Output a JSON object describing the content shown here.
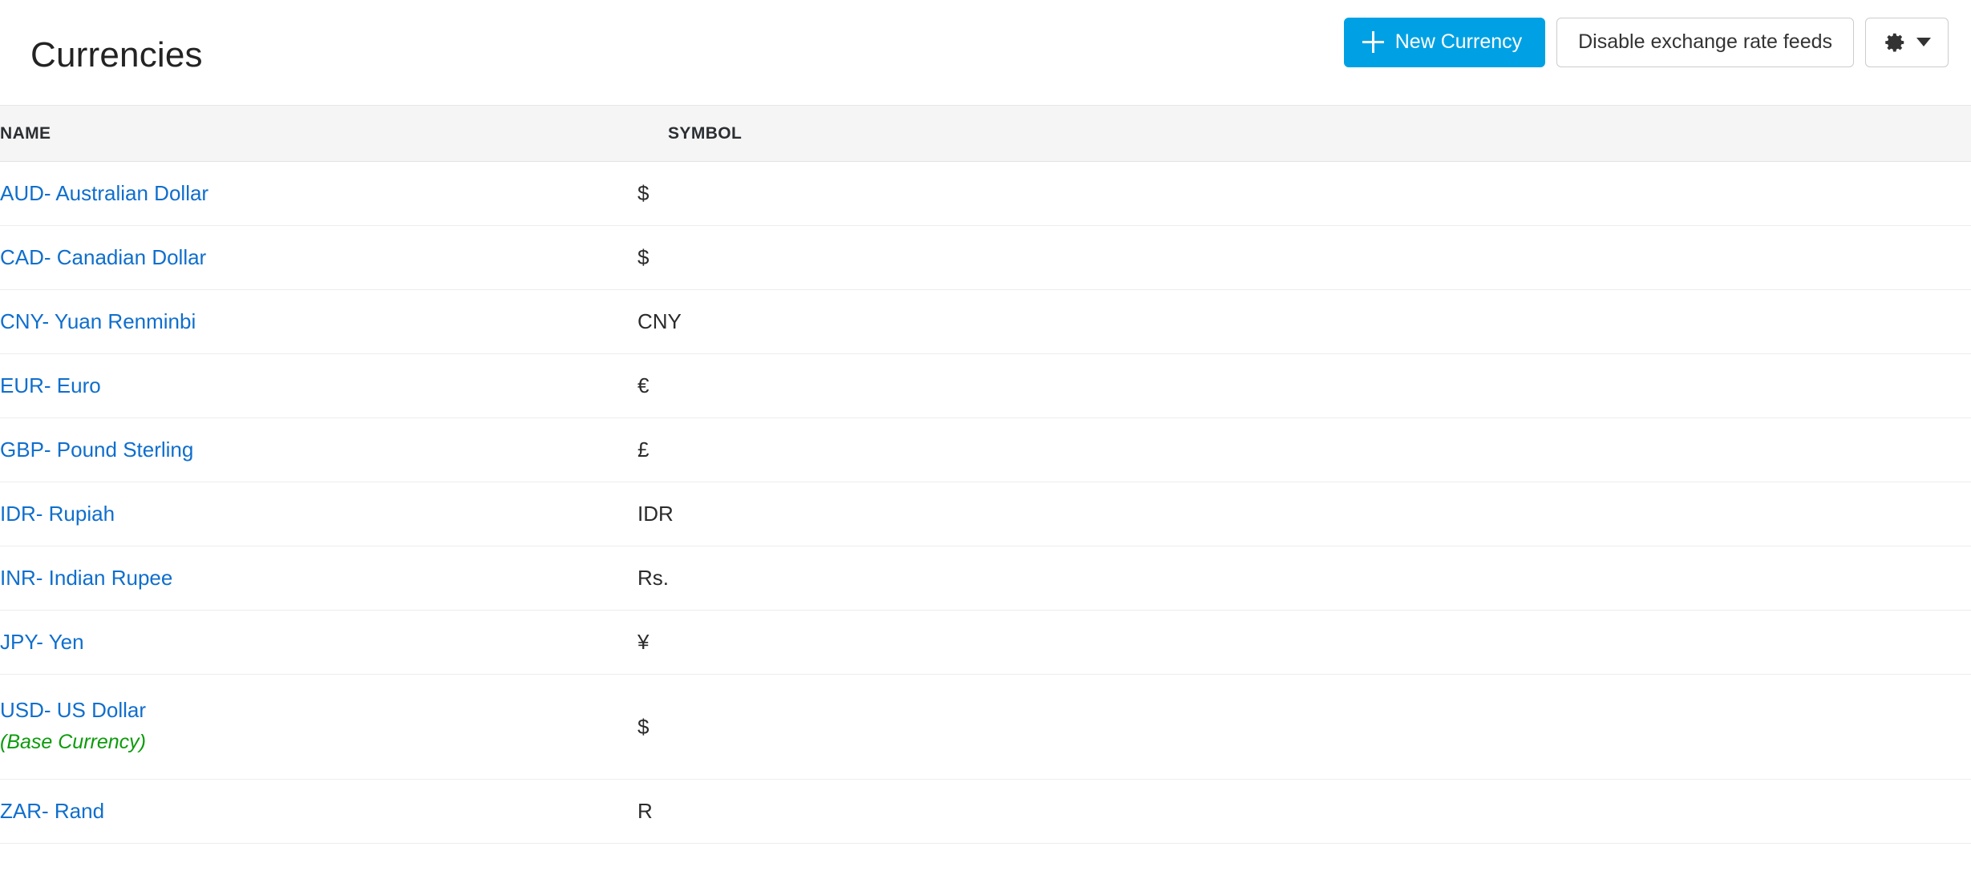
{
  "header": {
    "title": "Currencies",
    "actions": {
      "new_currency_label": "New Currency",
      "new_currency_icon": "plus-icon",
      "disable_feeds_label": "Disable exchange rate feeds",
      "settings_icon": "gear-icon",
      "settings_caret_icon": "chevron-down-icon"
    }
  },
  "table": {
    "columns": [
      {
        "key": "name",
        "label": "NAME"
      },
      {
        "key": "symbol",
        "label": "SYMBOL"
      }
    ],
    "rows": [
      {
        "name": "AUD- Australian Dollar",
        "symbol": "$",
        "note": ""
      },
      {
        "name": "CAD- Canadian Dollar",
        "symbol": "$",
        "note": ""
      },
      {
        "name": "CNY- Yuan Renminbi",
        "symbol": "CNY",
        "note": ""
      },
      {
        "name": "EUR- Euro",
        "symbol": "€",
        "note": ""
      },
      {
        "name": "GBP- Pound Sterling",
        "symbol": "£",
        "note": ""
      },
      {
        "name": "IDR- Rupiah",
        "symbol": "IDR",
        "note": ""
      },
      {
        "name": "INR- Indian Rupee",
        "symbol": "Rs.",
        "note": ""
      },
      {
        "name": "JPY- Yen",
        "symbol": "¥",
        "note": ""
      },
      {
        "name": "USD- US Dollar",
        "symbol": "$",
        "note": "(Base Currency)"
      },
      {
        "name": "ZAR- Rand",
        "symbol": "R",
        "note": ""
      }
    ]
  },
  "colors": {
    "primary_button": "#00a1e4",
    "link": "#0f6ecd",
    "base_currency_note": "#0b9b0b",
    "header_band": "#f5f5f5",
    "row_divider": "#eceded"
  }
}
